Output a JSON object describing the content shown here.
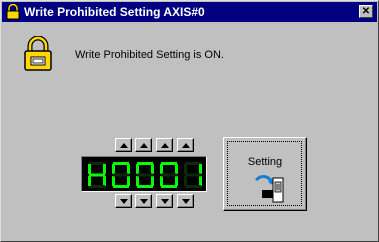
{
  "window": {
    "title": "Write Prohibited Setting AXIS#0",
    "close_label": "✕"
  },
  "message": "Write Prohibited Setting is ON.",
  "display": {
    "digits": [
      "H",
      "0",
      "0",
      "0",
      "1"
    ],
    "color": "#00ff00"
  },
  "increment_buttons": [
    "up",
    "up",
    "up",
    "up"
  ],
  "decrement_buttons": [
    "down",
    "down",
    "down",
    "down"
  ],
  "setting_button": {
    "label": "Setting",
    "icon": "write-protect-switch-icon"
  },
  "colors": {
    "titlebar": "#000080",
    "face": "#c0c0c0",
    "lock": "#ffd800"
  }
}
